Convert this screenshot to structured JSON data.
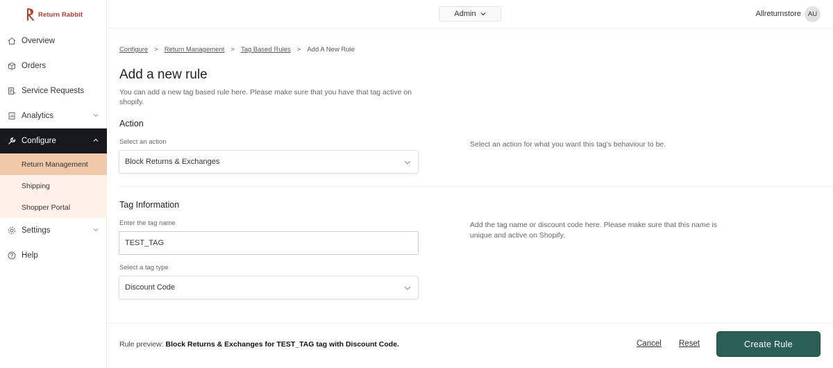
{
  "brand": {
    "name": "Return Rabbit",
    "color": "#c0392b"
  },
  "header": {
    "role": "Admin",
    "store": "Allreturnstore",
    "avatar_initials": "AU"
  },
  "sidebar": {
    "items": [
      {
        "label": "Overview",
        "icon": "home-icon"
      },
      {
        "label": "Orders",
        "icon": "box-icon"
      },
      {
        "label": "Service Requests",
        "icon": "clipboard-icon"
      },
      {
        "label": "Analytics",
        "icon": "chart-icon"
      },
      {
        "label": "Configure",
        "icon": "wrench-icon"
      },
      {
        "label": "Settings",
        "icon": "gear-icon"
      },
      {
        "label": "Help",
        "icon": "help-icon"
      }
    ],
    "configure_sub": [
      "Return Management",
      "Shipping",
      "Shopper Portal"
    ]
  },
  "breadcrumb": [
    "Configure",
    "Return Management",
    "Tag Based Rules",
    "Add A New Rule"
  ],
  "page": {
    "title": "Add a new rule",
    "description": "You can add a new tag based rule here. Please make sure that you have that tag active on shopify."
  },
  "action": {
    "title": "Action",
    "label": "Select an action",
    "value": "Block Returns & Exchanges",
    "help": "Select an action for what you want this tag's behaviour to be."
  },
  "tag_info": {
    "title": "Tag Information",
    "name_label": "Enter the tag name",
    "name_value": "TEST_TAG",
    "type_label": "Select a tag type",
    "type_value": "Discount Code",
    "help": "Add the tag name or discount code here. Please make sure that this name is unique and active on Shopify."
  },
  "footer": {
    "preview_prefix": "Rule preview:",
    "preview_text": "Block Returns & Exchanges for TEST_TAG tag with Discount Code.",
    "cancel": "Cancel",
    "reset": "Reset",
    "create": "Create Rule"
  },
  "colors": {
    "primary_button": "#2b5e56",
    "active_nav": "#16181d",
    "active_sub": "#efc9a9",
    "sub_bg": "#fdf0e8"
  }
}
